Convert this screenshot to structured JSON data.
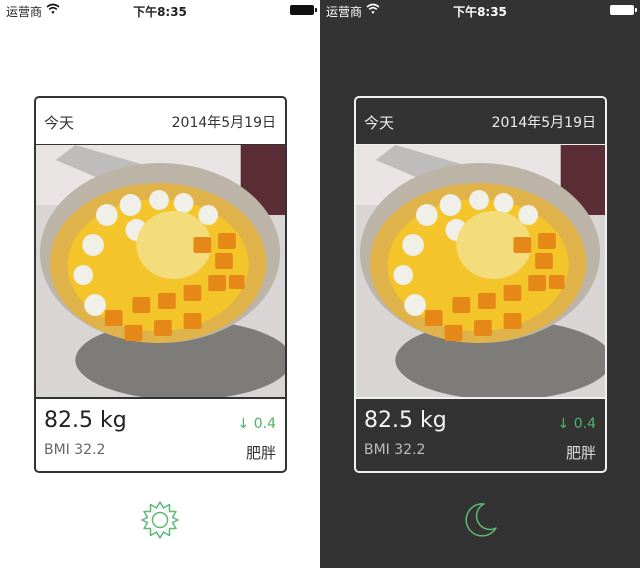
{
  "status_bar": {
    "carrier": "运营商",
    "time": "下午8:35"
  },
  "card": {
    "day_label": "今天",
    "date": "2014年5月19日",
    "weight": "82.5 kg",
    "change": "↓ 0.4",
    "bmi": "BMI 32.2",
    "category": "肥胖"
  },
  "theme_light": {
    "mode_icon": "sun-icon",
    "background": "#ffffff",
    "text": "#222222",
    "accent": "#5cba74"
  },
  "theme_dark": {
    "mode_icon": "moon-icon",
    "background": "#333333",
    "text": "#ffffff",
    "accent": "#5cba74"
  }
}
